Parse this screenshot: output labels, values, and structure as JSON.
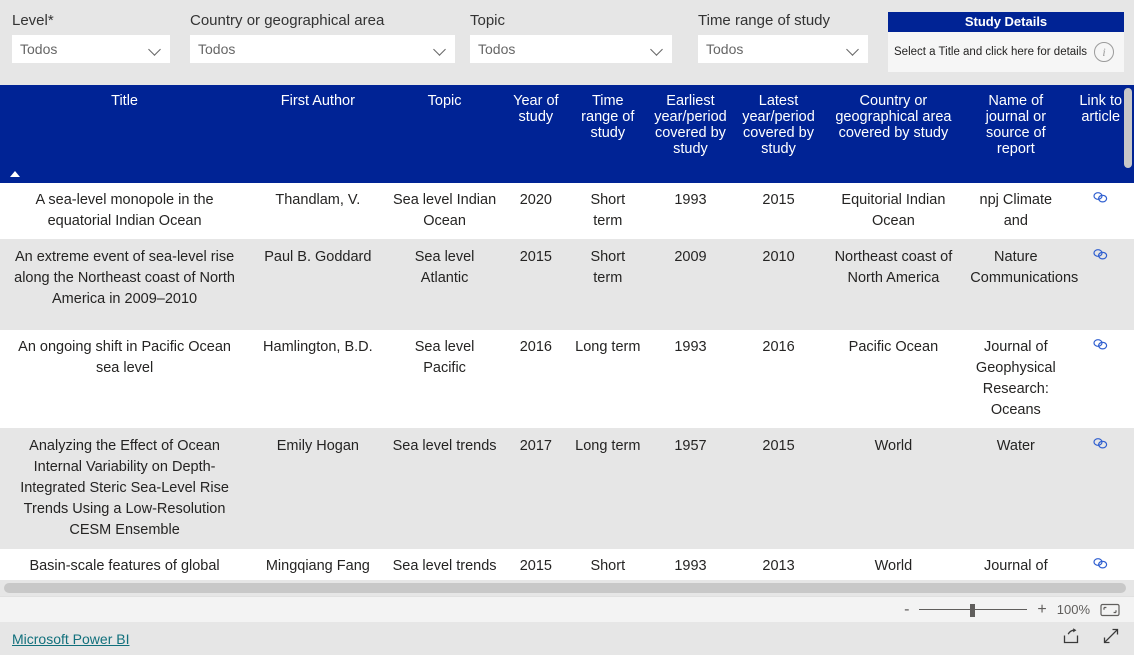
{
  "filters": [
    {
      "label": "Level*",
      "value": "Todos",
      "icon": "chevron-down-icon"
    },
    {
      "label": "Country or geographical area",
      "value": "Todos",
      "icon": "chevron-down-icon"
    },
    {
      "label": "Topic",
      "value": "Todos",
      "icon": "chevron-down-icon"
    },
    {
      "label": "Time range of study",
      "value": "Todos",
      "icon": "chevron-down-icon"
    }
  ],
  "study_details": {
    "header": "Study Details",
    "body_text": "Select a Title and click here for details",
    "icon": "info-icon"
  },
  "table": {
    "columns": [
      "Title",
      "First Author",
      "Topic",
      "Year of study",
      "Time range of study",
      "Earliest year/period covered by study",
      "Latest year/period covered by study",
      "Country or geographical area covered by study",
      "Name of journal or source of report",
      "Link to article"
    ],
    "sort_column": "Title",
    "sort_direction": "ascending",
    "rows": [
      {
        "title": "A sea-level monopole in the equatorial Indian Ocean",
        "first_author": "Thandlam, V.",
        "topic": "Sea level Indian Ocean",
        "year_of_study": "2020",
        "time_range": "Short term",
        "earliest_year": "1993",
        "latest_year": "2015",
        "country": "Equitorial Indian Ocean",
        "journal": "npj Climate and",
        "link": "link-icon"
      },
      {
        "title": "An extreme event of sea-level rise along the Northeast coast of North America in 2009–2010",
        "first_author": "Paul B. Goddard",
        "topic": "Sea level Atlantic",
        "year_of_study": "2015",
        "time_range": "Short term",
        "earliest_year": "2009",
        "latest_year": "2010",
        "country": "Northeast coast of North America",
        "journal": "Nature Communications",
        "link": "link-icon"
      },
      {
        "title": "An ongoing shift in Pacific Ocean sea level",
        "first_author": "Hamlington, B.D.",
        "topic": "Sea level Pacific",
        "year_of_study": "2016",
        "time_range": "Long term",
        "earliest_year": "1993",
        "latest_year": "2016",
        "country": "Pacific Ocean",
        "journal": "Journal of Geophysical Research: Oceans",
        "link": "link-icon"
      },
      {
        "title": "Analyzing the Effect of Ocean Internal Variability on Depth-Integrated Steric Sea-Level Rise Trends Using a Low-Resolution CESM Ensemble",
        "first_author": "Emily Hogan",
        "topic": "Sea level trends",
        "year_of_study": "2017",
        "time_range": "Long term",
        "earliest_year": "1957",
        "latest_year": "2015",
        "country": "World",
        "journal": "Water",
        "link": "link-icon"
      },
      {
        "title": "Basin-scale features of global",
        "first_author": "Mingqiang Fang",
        "topic": "Sea level trends",
        "year_of_study": "2015",
        "time_range": "Short",
        "earliest_year": "1993",
        "latest_year": "2013",
        "country": "World",
        "journal": "Journal of",
        "link": "link-icon"
      }
    ]
  },
  "zoom_bar": {
    "minus": "-",
    "plus": "+",
    "percent": "100%",
    "fit_icon": "fit-to-page-icon"
  },
  "footer": {
    "brand": "Microsoft Power BI",
    "share_icon": "share-icon",
    "fullscreen_icon": "fullscreen-icon"
  },
  "colors": {
    "header_blue": "#002395",
    "band_gray": "#e6e6e6",
    "brand_teal": "#11707c",
    "link_blue": "#2f5fd0"
  }
}
